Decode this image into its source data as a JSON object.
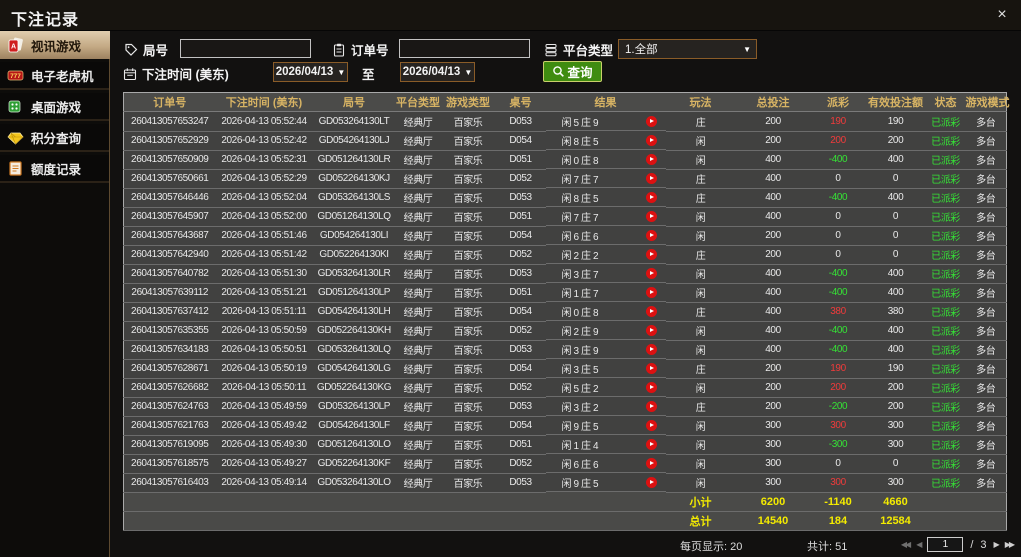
{
  "window": {
    "title": "下注记录",
    "close_glyph": "×"
  },
  "sidebar": {
    "items": [
      {
        "label": "视讯游戏",
        "selected": true
      },
      {
        "label": "电子老虎机",
        "selected": false
      },
      {
        "label": "桌面游戏",
        "selected": false
      },
      {
        "label": "积分查询",
        "selected": false
      },
      {
        "label": "额度记录",
        "selected": false
      }
    ]
  },
  "filters": {
    "round_label": "局号",
    "round_value": "",
    "order_label": "订单号",
    "order_value": "",
    "platform_label": "平台类型",
    "platform_value": "1.全部",
    "caret": "▼",
    "time_label": "下注时间 (美东)",
    "date_from": "2026/04/13",
    "to_label": "至",
    "date_to": "2026/04/13",
    "search_label": "查询"
  },
  "table": {
    "columns": [
      "订单号",
      "下注时间 (美东)",
      "局号",
      "平台类型",
      "游戏类型",
      "桌号",
      "结果",
      "玩法",
      "总投注",
      "派彩",
      "有效投注额",
      "状态",
      "游戏模式"
    ],
    "rows": [
      [
        "260413057653247",
        "2026-04-13 05:52:44",
        "GD053264130LT",
        "经典厅",
        "百家乐",
        "D053",
        "闲 5 庄 9",
        "庄",
        "200",
        "190",
        "190",
        "已派彩",
        "多台"
      ],
      [
        "260413057652929",
        "2026-04-13 05:52:42",
        "GD054264130LJ",
        "经典厅",
        "百家乐",
        "D054",
        "闲 8 庄 5",
        "闲",
        "200",
        "200",
        "200",
        "已派彩",
        "多台"
      ],
      [
        "260413057650909",
        "2026-04-13 05:52:31",
        "GD051264130LR",
        "经典厅",
        "百家乐",
        "D051",
        "闲 0 庄 8",
        "闲",
        "400",
        "-400",
        "400",
        "已派彩",
        "多台"
      ],
      [
        "260413057650661",
        "2026-04-13 05:52:29",
        "GD052264130KJ",
        "经典厅",
        "百家乐",
        "D052",
        "闲 7 庄 7",
        "庄",
        "400",
        "0",
        "0",
        "已派彩",
        "多台"
      ],
      [
        "260413057646446",
        "2026-04-13 05:52:04",
        "GD053264130LS",
        "经典厅",
        "百家乐",
        "D053",
        "闲 8 庄 5",
        "庄",
        "400",
        "-400",
        "400",
        "已派彩",
        "多台"
      ],
      [
        "260413057645907",
        "2026-04-13 05:52:00",
        "GD051264130LQ",
        "经典厅",
        "百家乐",
        "D051",
        "闲 7 庄 7",
        "闲",
        "400",
        "0",
        "0",
        "已派彩",
        "多台"
      ],
      [
        "260413057643687",
        "2026-04-13 05:51:46",
        "GD054264130LI",
        "经典厅",
        "百家乐",
        "D054",
        "闲 6 庄 6",
        "闲",
        "200",
        "0",
        "0",
        "已派彩",
        "多台"
      ],
      [
        "260413057642940",
        "2026-04-13 05:51:42",
        "GD052264130KI",
        "经典厅",
        "百家乐",
        "D052",
        "闲 2 庄 2",
        "庄",
        "200",
        "0",
        "0",
        "已派彩",
        "多台"
      ],
      [
        "260413057640782",
        "2026-04-13 05:51:30",
        "GD053264130LR",
        "经典厅",
        "百家乐",
        "D053",
        "闲 3 庄 7",
        "闲",
        "400",
        "-400",
        "400",
        "已派彩",
        "多台"
      ],
      [
        "260413057639112",
        "2026-04-13 05:51:21",
        "GD051264130LP",
        "经典厅",
        "百家乐",
        "D051",
        "闲 1 庄 7",
        "闲",
        "400",
        "-400",
        "400",
        "已派彩",
        "多台"
      ],
      [
        "260413057637412",
        "2026-04-13 05:51:11",
        "GD054264130LH",
        "经典厅",
        "百家乐",
        "D054",
        "闲 0 庄 8",
        "庄",
        "400",
        "380",
        "380",
        "已派彩",
        "多台"
      ],
      [
        "260413057635355",
        "2026-04-13 05:50:59",
        "GD052264130KH",
        "经典厅",
        "百家乐",
        "D052",
        "闲 2 庄 9",
        "闲",
        "400",
        "-400",
        "400",
        "已派彩",
        "多台"
      ],
      [
        "260413057634183",
        "2026-04-13 05:50:51",
        "GD053264130LQ",
        "经典厅",
        "百家乐",
        "D053",
        "闲 3 庄 9",
        "闲",
        "400",
        "-400",
        "400",
        "已派彩",
        "多台"
      ],
      [
        "260413057628671",
        "2026-04-13 05:50:19",
        "GD054264130LG",
        "经典厅",
        "百家乐",
        "D054",
        "闲 3 庄 5",
        "庄",
        "200",
        "190",
        "190",
        "已派彩",
        "多台"
      ],
      [
        "260413057626682",
        "2026-04-13 05:50:11",
        "GD052264130KG",
        "经典厅",
        "百家乐",
        "D052",
        "闲 5 庄 2",
        "闲",
        "200",
        "200",
        "200",
        "已派彩",
        "多台"
      ],
      [
        "260413057624763",
        "2026-04-13 05:49:59",
        "GD053264130LP",
        "经典厅",
        "百家乐",
        "D053",
        "闲 3 庄 2",
        "庄",
        "200",
        "-200",
        "200",
        "已派彩",
        "多台"
      ],
      [
        "260413057621763",
        "2026-04-13 05:49:42",
        "GD054264130LF",
        "经典厅",
        "百家乐",
        "D054",
        "闲 9 庄 5",
        "闲",
        "300",
        "300",
        "300",
        "已派彩",
        "多台"
      ],
      [
        "260413057619095",
        "2026-04-13 05:49:30",
        "GD051264130LO",
        "经典厅",
        "百家乐",
        "D051",
        "闲 1 庄 4",
        "闲",
        "300",
        "-300",
        "300",
        "已派彩",
        "多台"
      ],
      [
        "260413057618575",
        "2026-04-13 05:49:27",
        "GD052264130KF",
        "经典厅",
        "百家乐",
        "D052",
        "闲 6 庄 6",
        "闲",
        "300",
        "0",
        "0",
        "已派彩",
        "多台"
      ],
      [
        "260413057616403",
        "2026-04-13 05:49:14",
        "GD053264130LO",
        "经典厅",
        "百家乐",
        "D053",
        "闲 9 庄 5",
        "闲",
        "300",
        "300",
        "300",
        "已派彩",
        "多台"
      ]
    ],
    "subtotal": {
      "label": "小计",
      "total_bet": "6200",
      "payout": "-1140",
      "valid_bet": "4660"
    },
    "grand_total": {
      "label": "总计",
      "total_bet": "14540",
      "payout": "184",
      "valid_bet": "12584"
    }
  },
  "pagination": {
    "page_size_label": "每页显示: 20",
    "total_label": "共计: 51",
    "page": "1",
    "sep": "/",
    "total_pages": "3",
    "first_glyph": "◀◀",
    "prev_glyph": "◀",
    "next_glyph": "▶",
    "last_glyph": "▶▶"
  },
  "colors": {
    "accent_gold": "#d8b464",
    "win_red": "#f03b3b",
    "loss_green": "#35e235",
    "total_yellow": "#f4eb00",
    "search_green": "#3f8c10",
    "border_orange": "#8a5c28"
  }
}
